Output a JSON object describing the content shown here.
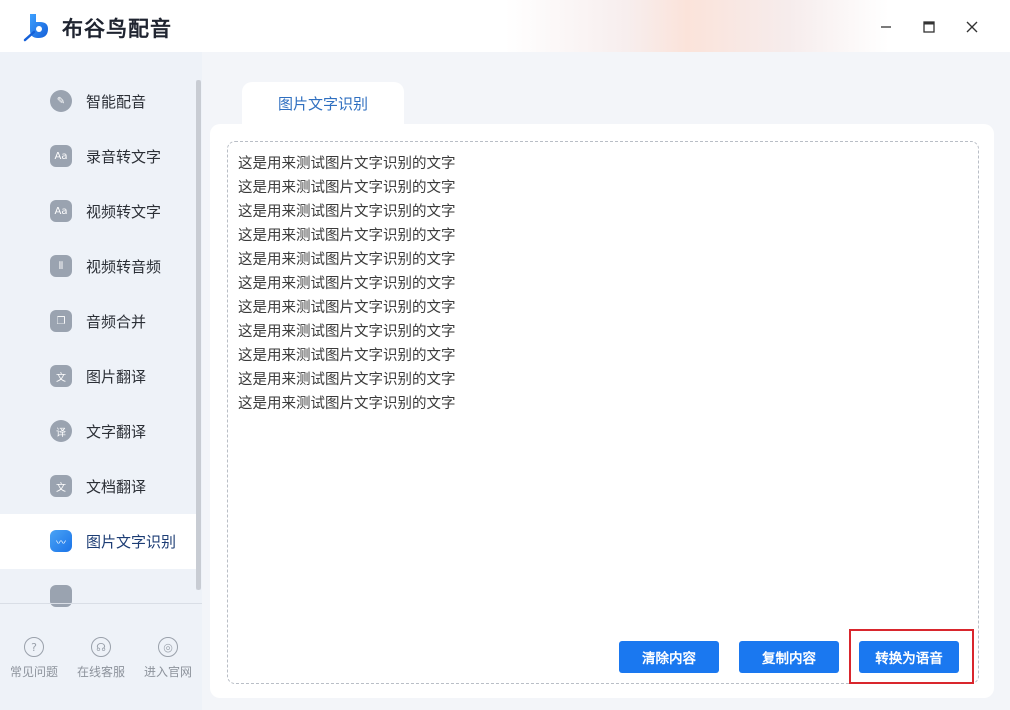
{
  "app": {
    "title": "布谷鸟配音"
  },
  "window": {
    "minimize": "—",
    "maximize": "▢",
    "close": "✕"
  },
  "sidebar": {
    "items": [
      {
        "label": "智能配音",
        "icon": "mic-icon",
        "glyph": "✎"
      },
      {
        "label": "录音转文字",
        "icon": "speech-to-text-icon",
        "glyph": "Aa"
      },
      {
        "label": "视频转文字",
        "icon": "video-to-text-icon",
        "glyph": "Aa"
      },
      {
        "label": "视频转音频",
        "icon": "waveform-icon",
        "glyph": "⦀"
      },
      {
        "label": "音频合并",
        "icon": "merge-icon",
        "glyph": "❐"
      },
      {
        "label": "图片翻译",
        "icon": "image-translate-icon",
        "glyph": "文"
      },
      {
        "label": "文字翻译",
        "icon": "text-translate-icon",
        "glyph": "译"
      },
      {
        "label": "文档翻译",
        "icon": "document-translate-icon",
        "glyph": "文"
      },
      {
        "label": "图片文字识别",
        "icon": "image-ocr-icon",
        "glyph": "〰",
        "active": true
      },
      {
        "label": "",
        "icon": "more-icon",
        "glyph": ""
      }
    ],
    "bottom": [
      {
        "label": "常见问题",
        "icon": "help-icon",
        "glyph": "?"
      },
      {
        "label": "在线客服",
        "icon": "headset-icon",
        "glyph": "☊"
      },
      {
        "label": "进入官网",
        "icon": "globe-icon",
        "glyph": "◎"
      }
    ]
  },
  "main": {
    "tab": "图片文字识别",
    "lines": [
      "这是用来测试图片文字识别的文字",
      "这是用来测试图片文字识别的文字",
      "这是用来测试图片文字识别的文字",
      "这是用来测试图片文字识别的文字",
      "这是用来测试图片文字识别的文字",
      "这是用来测试图片文字识别的文字",
      "这是用来测试图片文字识别的文字",
      "这是用来测试图片文字识别的文字",
      "这是用来测试图片文字识别的文字",
      "这是用来测试图片文字识别的文字",
      "这是用来测试图片文字识别的文字"
    ],
    "buttons": {
      "clear": "清除内容",
      "copy": "复制内容",
      "convert": "转换为语音"
    }
  },
  "colors": {
    "accent": "#1a78f0",
    "highlight": "#d9262d",
    "sidebar_bg": "#eef2f8"
  }
}
